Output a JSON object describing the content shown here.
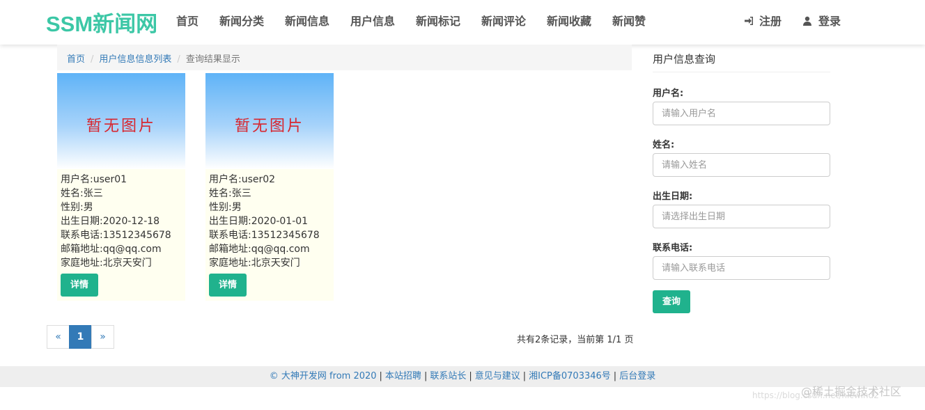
{
  "brand": "SSM新闻网",
  "nav": {
    "items": [
      "首页",
      "新闻分类",
      "新闻信息",
      "用户信息",
      "新闻标记",
      "新闻评论",
      "新闻收藏",
      "新闻赞"
    ],
    "register": "注册",
    "login": "登录"
  },
  "breadcrumb": {
    "home": "首页",
    "list": "用户信息信息列表",
    "current": "查询结果显示"
  },
  "cards": [
    {
      "image_text": "暂无图片",
      "lines": [
        "用户名:user01",
        "姓名:张三",
        "性别:男",
        "出生日期:2020-12-18",
        "联系电话:13512345678",
        "邮箱地址:qq@qq.com",
        "家庭地址:北京天安门"
      ],
      "button": "详情"
    },
    {
      "image_text": "暂无图片",
      "lines": [
        "用户名:user02",
        "姓名:张三",
        "性别:男",
        "出生日期:2020-01-01",
        "联系电话:13512345678",
        "邮箱地址:qq@qq.com",
        "家庭地址:北京天安门"
      ],
      "button": "详情"
    }
  ],
  "pagination": {
    "prev": "«",
    "current": "1",
    "next": "»",
    "info": "共有2条记录，当前第 1/1 页"
  },
  "search": {
    "title": "用户信息查询",
    "fields": [
      {
        "label": "用户名:",
        "placeholder": "请输入用户名"
      },
      {
        "label": "姓名:",
        "placeholder": "请输入姓名"
      },
      {
        "label": "出生日期:",
        "placeholder": "请选择出生日期"
      },
      {
        "label": "联系电话:",
        "placeholder": "请输入联系电话"
      }
    ],
    "button": "查询"
  },
  "footer": {
    "copyright": "© 大神开发网 from 2020",
    "links": [
      "本站招聘",
      "联系站长",
      "意见与建议",
      "湘ICP备0703346号",
      "后台登录"
    ]
  },
  "watermark": "@稀土掘金技术社区",
  "watermark_url": "https://blog.csdn.net/nicwind2"
}
